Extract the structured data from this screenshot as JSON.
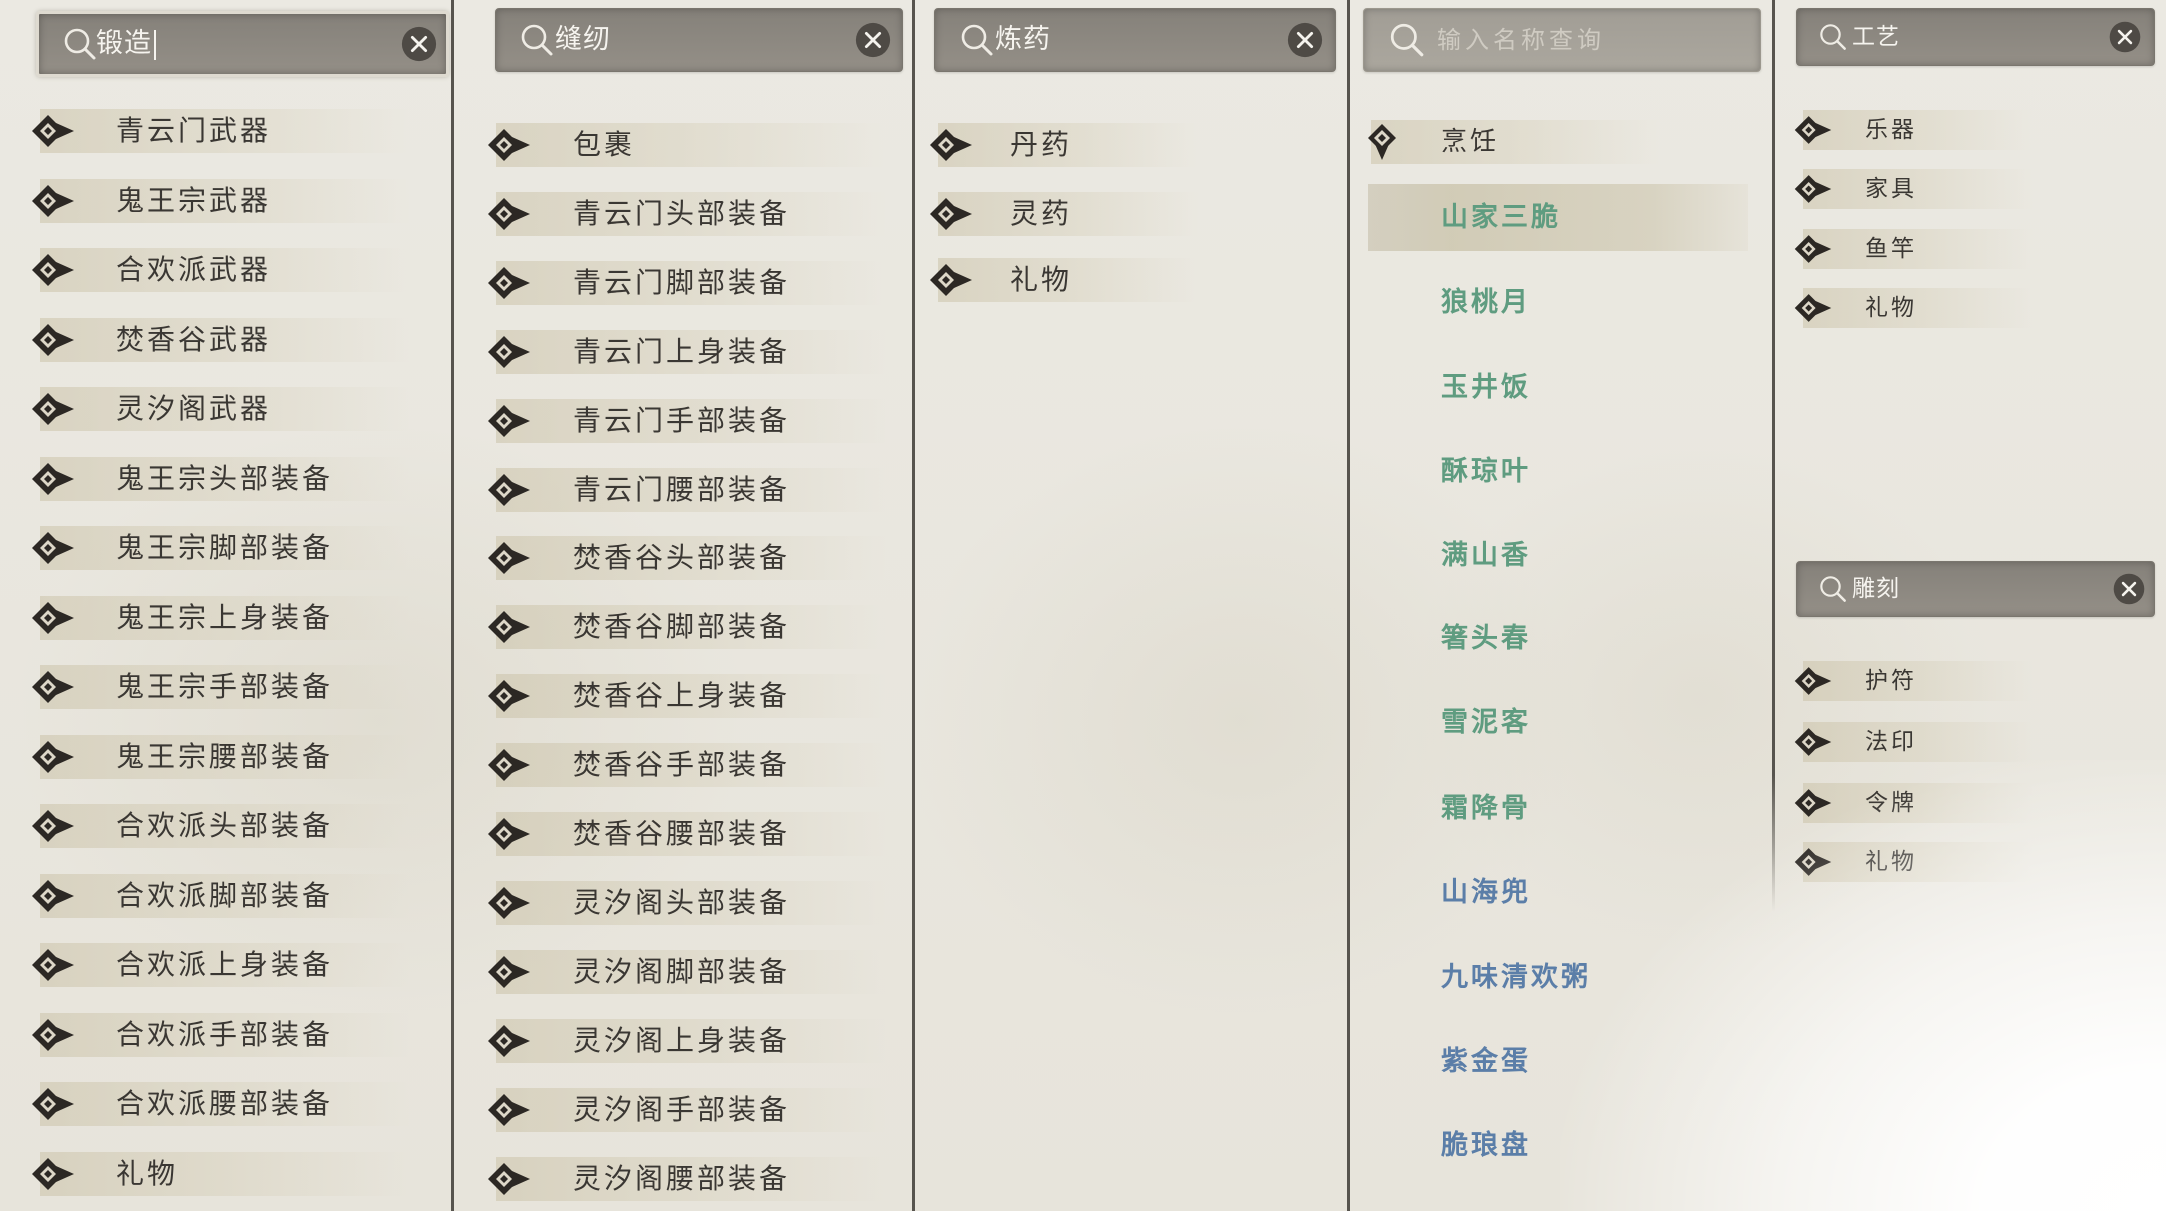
{
  "panels": [
    {
      "search": {
        "value": "锻造"
      },
      "items": [
        "青云门武器",
        "鬼王宗武器",
        "合欢派武器",
        "焚香谷武器",
        "灵汐阁武器",
        "鬼王宗头部装备",
        "鬼王宗脚部装备",
        "鬼王宗上身装备",
        "鬼王宗手部装备",
        "鬼王宗腰部装备",
        "合欢派头部装备",
        "合欢派脚部装备",
        "合欢派上身装备",
        "合欢派手部装备",
        "合欢派腰部装备",
        "礼物"
      ]
    },
    {
      "search": {
        "value": "缝纫"
      },
      "items": [
        "包裹",
        "青云门头部装备",
        "青云门脚部装备",
        "青云门上身装备",
        "青云门手部装备",
        "青云门腰部装备",
        "焚香谷头部装备",
        "焚香谷脚部装备",
        "焚香谷上身装备",
        "焚香谷手部装备",
        "焚香谷腰部装备",
        "灵汐阁头部装备",
        "灵汐阁脚部装备",
        "灵汐阁上身装备",
        "灵汐阁手部装备",
        "灵汐阁腰部装备"
      ]
    },
    {
      "search": {
        "value": "炼药"
      },
      "items": [
        "丹药",
        "灵药",
        "礼物"
      ]
    },
    {
      "search": {
        "placeholder": "输入名称查询"
      },
      "category": {
        "label": "烹饪",
        "expanded": true,
        "items": [
          {
            "label": "山家三脆",
            "color": "#5f9c80",
            "selected": true
          },
          {
            "label": "狼桃月",
            "color": "#5f9c80"
          },
          {
            "label": "玉井饭",
            "color": "#5f9c80"
          },
          {
            "label": "酥琼叶",
            "color": "#5f9c80"
          },
          {
            "label": "满山香",
            "color": "#5f9c80"
          },
          {
            "label": "箸头春",
            "color": "#5f9c80"
          },
          {
            "label": "雪泥客",
            "color": "#5f9c80"
          },
          {
            "label": "霜降骨",
            "color": "#5f9c80"
          },
          {
            "label": "山海兜",
            "color": "#5b7ea8"
          },
          {
            "label": "九味清欢粥",
            "color": "#5b7ea8"
          },
          {
            "label": "紫金蛋",
            "color": "#5b7ea8"
          },
          {
            "label": "脆琅盘",
            "color": "#5b7ea8"
          }
        ]
      }
    },
    {
      "groups": [
        {
          "search": {
            "value": "工艺"
          },
          "items": [
            "乐器",
            "家具",
            "鱼竿",
            "礼物"
          ]
        },
        {
          "search": {
            "value": "雕刻"
          },
          "items": [
            "护符",
            "法印",
            "令牌",
            "礼物"
          ]
        }
      ]
    }
  ],
  "colors": {
    "background": "#ebe8e0",
    "item_text": "#3a3733",
    "search_text": "#f6f4ef",
    "placeholder": "#cfcbc2",
    "divider": "#57544e",
    "recipe_green": "#5f9c80",
    "recipe_blue": "#5b7ea8",
    "selected_row": "#cdc6b0"
  },
  "icons": {
    "search": "search-icon",
    "clear": "close-icon",
    "collapsed": "diamond-arrow-right-icon",
    "expanded": "diamond-arrow-down-icon"
  }
}
